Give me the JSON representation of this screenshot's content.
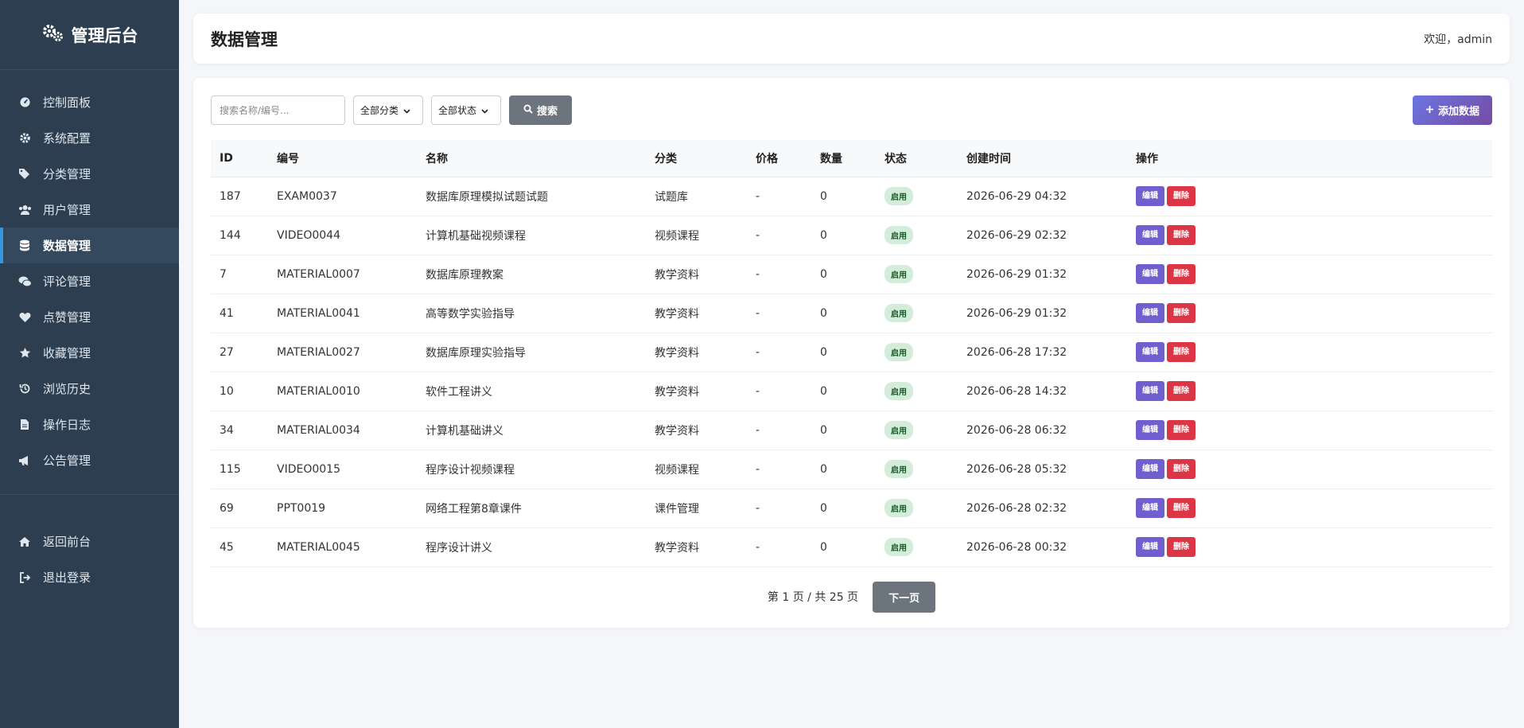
{
  "sidebar": {
    "brand": "管理后台",
    "items": [
      {
        "label": "控制面板",
        "icon": "dashboard-icon"
      },
      {
        "label": "系统配置",
        "icon": "gear-icon"
      },
      {
        "label": "分类管理",
        "icon": "tags-icon"
      },
      {
        "label": "用户管理",
        "icon": "users-icon"
      },
      {
        "label": "数据管理",
        "icon": "database-icon",
        "active": true
      },
      {
        "label": "评论管理",
        "icon": "comments-icon"
      },
      {
        "label": "点赞管理",
        "icon": "heart-icon"
      },
      {
        "label": "收藏管理",
        "icon": "star-icon"
      },
      {
        "label": "浏览历史",
        "icon": "history-icon"
      },
      {
        "label": "操作日志",
        "icon": "file-icon"
      },
      {
        "label": "公告管理",
        "icon": "bullhorn-icon"
      }
    ],
    "bottom": [
      {
        "label": "返回前台",
        "icon": "home-icon"
      },
      {
        "label": "退出登录",
        "icon": "sign-out-icon"
      }
    ]
  },
  "header": {
    "title": "数据管理",
    "welcome": "欢迎，admin"
  },
  "toolbar": {
    "search_placeholder": "搜索名称/编号...",
    "category_select": "全部分类",
    "status_select": "全部状态",
    "search_label": "搜索",
    "add_label": "添加数据"
  },
  "table": {
    "columns": [
      "ID",
      "编号",
      "名称",
      "分类",
      "价格",
      "数量",
      "状态",
      "创建时间",
      "操作"
    ],
    "edit_label": "编辑",
    "delete_label": "删除",
    "rows": [
      [
        "187",
        "EXAM0037",
        "数据库原理模拟试题试题",
        "试题库",
        "-",
        "0",
        "启用",
        "2026-06-29 04:32"
      ],
      [
        "144",
        "VIDEO0044",
        "计算机基础视频课程",
        "视频课程",
        "-",
        "0",
        "启用",
        "2026-06-29 02:32"
      ],
      [
        "7",
        "MATERIAL0007",
        "数据库原理教案",
        "教学资料",
        "-",
        "0",
        "启用",
        "2026-06-29 01:32"
      ],
      [
        "41",
        "MATERIAL0041",
        "高等数学实验指导",
        "教学资料",
        "-",
        "0",
        "启用",
        "2026-06-29 01:32"
      ],
      [
        "27",
        "MATERIAL0027",
        "数据库原理实验指导",
        "教学资料",
        "-",
        "0",
        "启用",
        "2026-06-28 17:32"
      ],
      [
        "10",
        "MATERIAL0010",
        "软件工程讲义",
        "教学资料",
        "-",
        "0",
        "启用",
        "2026-06-28 14:32"
      ],
      [
        "34",
        "MATERIAL0034",
        "计算机基础讲义",
        "教学资料",
        "-",
        "0",
        "启用",
        "2026-06-28 06:32"
      ],
      [
        "115",
        "VIDEO0015",
        "程序设计视频课程",
        "视频课程",
        "-",
        "0",
        "启用",
        "2026-06-28 05:32"
      ],
      [
        "69",
        "PPT0019",
        "网络工程第8章课件",
        "课件管理",
        "-",
        "0",
        "启用",
        "2026-06-28 02:32"
      ],
      [
        "45",
        "MATERIAL0045",
        "程序设计讲义",
        "教学资料",
        "-",
        "0",
        "启用",
        "2026-06-28 00:32"
      ]
    ]
  },
  "pagination": {
    "info": "第 1 页 / 共 25 页",
    "next_label": "下一页"
  },
  "colors": {
    "sidebar_bg": "#2c3e50",
    "accent": "#3498db",
    "add_button": "#6a75e0",
    "delete": "#dc3545",
    "badge_bg": "#d4edda"
  }
}
